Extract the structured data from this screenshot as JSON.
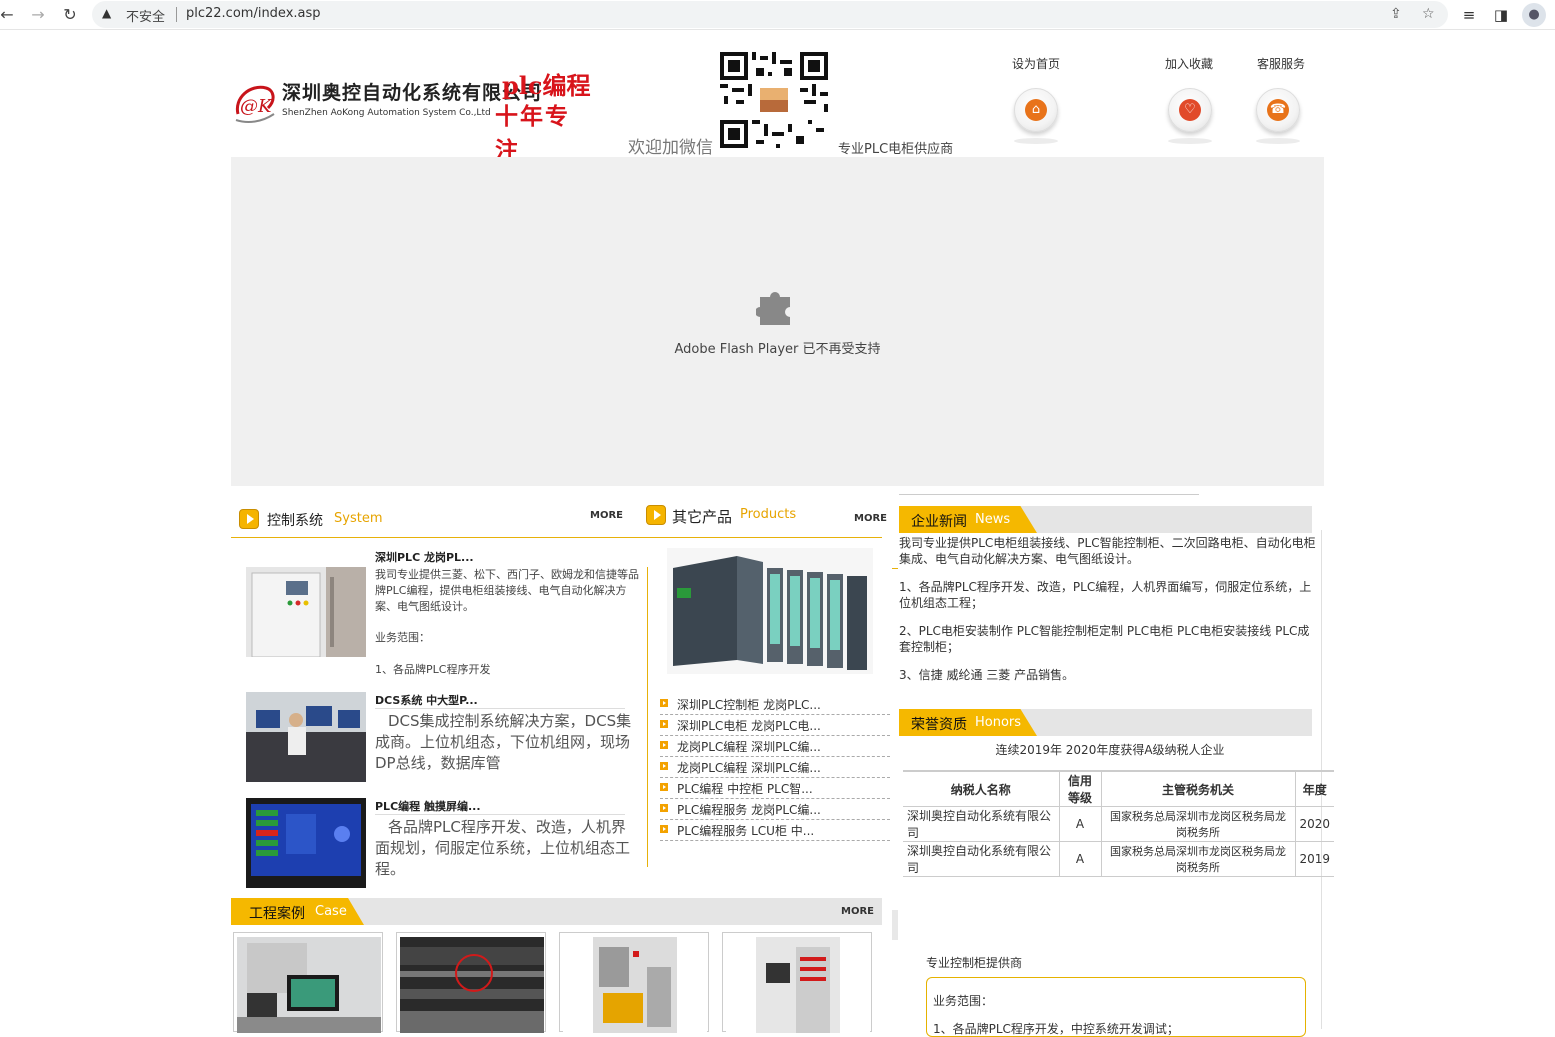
{
  "browser": {
    "insecure_label": "不安全",
    "url": "plc22.com/index.asp"
  },
  "header": {
    "company_cn": "深圳奥控自动化系统有限公司",
    "company_en": "ShenZhen AoKong Automation System Co.,Ltd",
    "slogan_1": "plc编程",
    "slogan_2": "十年专注",
    "wechat_text": "欢迎加微信",
    "supplier_text": "专业PLC电柜供应商",
    "links": [
      "设为首页",
      "加入收藏",
      "客服服务"
    ]
  },
  "flash": {
    "message": "Adobe Flash Player 已不再受支持"
  },
  "system": {
    "title_cn": "控制系统",
    "title_en": "System",
    "more": "MORE",
    "items": [
      {
        "title": "深圳PLC 龙岗PL...",
        "text": "我司专业提供三菱、松下、西门子、欧姆龙和信捷等品牌PLC编程，提供电柜组装接线、电气自动化解决方案、电气图纸设计。",
        "extra1": "业务范围：",
        "extra2": "1、各品牌PLC程序开发"
      },
      {
        "title": "DCS系统 中大型P...",
        "text": "DCS集成控制系统解决方案，DCS集成商。上位机组态，下位机组网，现场DP总线，数据库管"
      },
      {
        "title": "PLC编程 触摸屏编...",
        "text": "各品牌PLC程序开发、改造，人机界面规划，伺服定位系统，上位机组态工程。"
      }
    ]
  },
  "products": {
    "title_cn": "其它产品",
    "title_en": "Products",
    "more": "MORE",
    "list": [
      "深圳PLC控制柜 龙岗PLC...",
      "深圳PLC电柜 龙岗PLC电...",
      "龙岗PLC编程 深圳PLC编...",
      "龙岗PLC编程 深圳PLC编...",
      "PLC编程 中控柜 PLC智...",
      "PLC编程服务 龙岗PLC编...",
      "PLC编程服务 LCU柜 中..."
    ]
  },
  "news": {
    "title_cn": "企业新闻",
    "title_en": "News",
    "p1": "我司专业提供PLC电柜组装接线、PLC智能控制柜、二次回路电柜、自动化电柜集成、电气自动化解决方案、电气图纸设计。",
    "p2": "1、各品牌PLC程序开发、改造，PLC编程，人机界面编写，伺服定位系统，上位机组态工程；",
    "p3": "2、PLC电柜安装制作 PLC智能控制柜定制 PLC电柜 PLC电柜安装接线 PLC成套控制柜；",
    "p4": "3、信捷 威纶通 三菱 产品销售。"
  },
  "honors": {
    "title_cn": "荣誉资质",
    "title_en": "Honors",
    "caption": "连续2019年 2020年度获得A级纳税人企业",
    "headers": [
      "纳税人名称",
      "信用等级",
      "主管税务机关",
      "年度"
    ],
    "rows": [
      [
        "深圳奥控自动化系统有限公司",
        "A",
        "国家税务总局深圳市龙岗区税务局龙岗税务所",
        "2020"
      ],
      [
        "深圳奥控自动化系统有限公司",
        "A",
        "国家税务总局深圳市龙岗区税务局龙岗税务所",
        "2019"
      ]
    ]
  },
  "case": {
    "title_cn": "工程案例",
    "title_en": "Case",
    "more": "MORE"
  },
  "footer_info": {
    "supplier": "专业控制柜提供商",
    "scope_label": "业务范围：",
    "scope_line": "1、各品牌PLC程序开发，中控系统开发调试；"
  }
}
